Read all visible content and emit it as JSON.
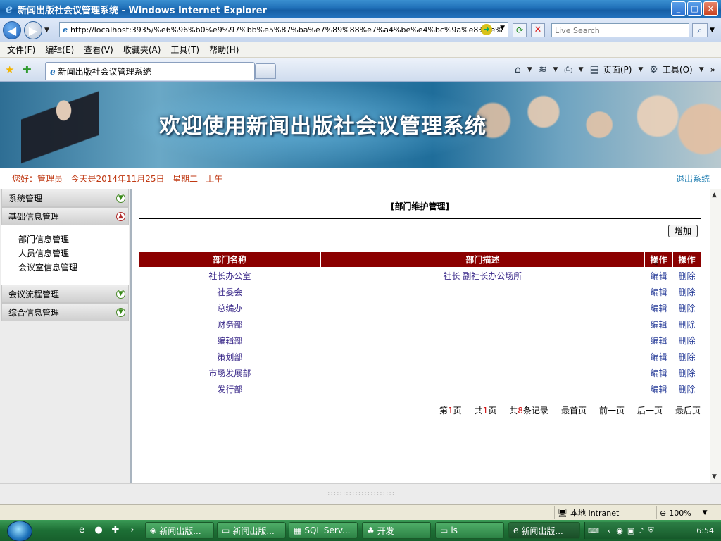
{
  "window": {
    "title": "新闻出版社会议管理系统 - Windows Internet Explorer"
  },
  "address_bar": {
    "url": "http://localhost:3935/%e6%96%b0%e9%97%bb%e5%87%ba%e7%89%88%e7%a4%be%e4%bc%9a%e8%ae%",
    "search_placeholder": "Live Search"
  },
  "menu": {
    "items": [
      "文件(F)",
      "编辑(E)",
      "查看(V)",
      "收藏夹(A)",
      "工具(T)",
      "帮助(H)"
    ]
  },
  "tabs": {
    "active_label": "新闻出版社会议管理系统"
  },
  "command_bar": {
    "page_label": "页面(P)",
    "tools_label": "工具(O)"
  },
  "banner": {
    "title": "欢迎使用新闻出版社会议管理系统"
  },
  "greeting": {
    "text": "您好：管理员   今天是2014年11月25日   星期二   上午",
    "logout": "退出系统"
  },
  "sidebar": {
    "sections": [
      {
        "label": "系统管理",
        "expanded": false
      },
      {
        "label": "基础信息管理",
        "expanded": true
      },
      {
        "label": "会议流程管理",
        "expanded": false
      },
      {
        "label": "综合信息管理",
        "expanded": false
      }
    ],
    "sub_items": [
      "部门信息管理",
      "人员信息管理",
      "会议室信息管理"
    ]
  },
  "main": {
    "title": "[部门维护管理]",
    "add_button": "增加",
    "columns": [
      "部门名称",
      "部门描述",
      "操作",
      "操作"
    ],
    "rows": [
      {
        "name": "社长办公室",
        "desc": "社长 副社长办公场所",
        "edit": "编辑",
        "delete": "删除"
      },
      {
        "name": "社委会",
        "desc": "",
        "edit": "编辑",
        "delete": "删除"
      },
      {
        "name": "总编办",
        "desc": "",
        "edit": "编辑",
        "delete": "删除"
      },
      {
        "name": "财务部",
        "desc": "",
        "edit": "编辑",
        "delete": "删除"
      },
      {
        "name": "编辑部",
        "desc": "",
        "edit": "编辑",
        "delete": "删除"
      },
      {
        "name": "策划部",
        "desc": "",
        "edit": "编辑",
        "delete": "删除"
      },
      {
        "name": "市场发展部",
        "desc": "",
        "edit": "编辑",
        "delete": "删除"
      },
      {
        "name": "发行部",
        "desc": "",
        "edit": "编辑",
        "delete": "删除"
      }
    ],
    "pager": {
      "page_prefix": "第",
      "page_num": "1",
      "page_suffix": "页",
      "total_prefix": "共",
      "total_num": "1",
      "total_suffix": "页",
      "records_prefix": "共",
      "records_num": "8",
      "records_suffix": "条记录",
      "first": "最首页",
      "prev": "前一页",
      "next": "后一页",
      "last": "最后页"
    }
  },
  "footer": {
    "dots": "::::::::::::::::::::::"
  },
  "status_bar": {
    "zone": "本地 Intranet",
    "zoom": "100%"
  },
  "taskbar": {
    "tasks": [
      "新闻出版...",
      "新闻出版...",
      "SQL Serv...",
      "开发",
      "ls",
      "新闻出版..."
    ],
    "clock": "6:54"
  },
  "colors": {
    "table_header": "#8b0000",
    "greeting_text": "#c03a14",
    "logout_link": "#1a7bb0",
    "pager_number": "#d01010"
  }
}
